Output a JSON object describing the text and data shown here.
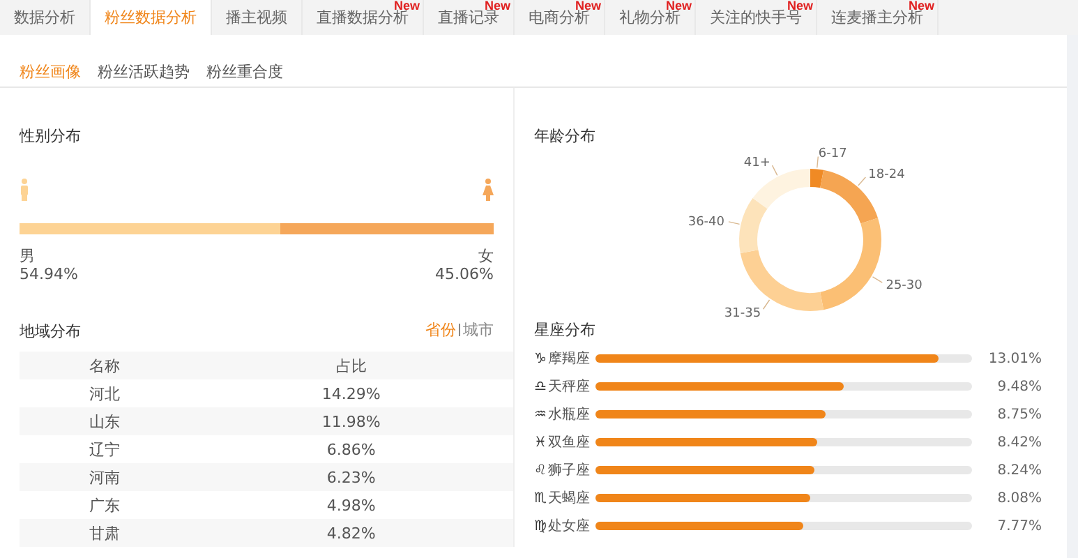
{
  "tabs": [
    {
      "label": "数据分析",
      "selected": false
    },
    {
      "label": "粉丝数据分析",
      "selected": true
    },
    {
      "label": "播主视频",
      "selected": false
    },
    {
      "label": "直播数据分析",
      "selected": false,
      "badge": "New"
    },
    {
      "label": "直播记录",
      "selected": false,
      "badge": "New"
    },
    {
      "label": "电商分析",
      "selected": false,
      "badge": "New"
    },
    {
      "label": "礼物分析",
      "selected": false,
      "badge": "New"
    },
    {
      "label": "关注的快手号",
      "selected": false,
      "badge": "New"
    },
    {
      "label": "连麦播主分析",
      "selected": false,
      "badge": "New"
    }
  ],
  "subtabs": [
    {
      "label": "粉丝画像",
      "selected": true
    },
    {
      "label": "粉丝活跃趋势",
      "selected": false
    },
    {
      "label": "粉丝重合度",
      "selected": false
    }
  ],
  "gender": {
    "title": "性别分布",
    "male_label": "男",
    "male_percent": "54.94%",
    "female_label": "女",
    "female_percent": "45.06%",
    "level": 0.5494
  },
  "age": {
    "title": "年龄分布",
    "segments": [
      {
        "label": "6-17",
        "color": "#f08a24"
      },
      {
        "label": "18-24",
        "color": "#f5a552"
      },
      {
        "label": "25-30",
        "color": "#fbbf74"
      },
      {
        "label": "31-35",
        "color": "#fdd094"
      },
      {
        "label": "36-40",
        "color": "#fde3ba"
      },
      {
        "label": "41+",
        "color": "#fef3e0"
      }
    ]
  },
  "region": {
    "title": "地域分布",
    "toggle": [
      {
        "label": "省份",
        "selected": true
      },
      {
        "label": "城市",
        "selected": false
      }
    ],
    "columns": [
      "名称",
      "占比"
    ],
    "rows": [
      [
        "河北",
        "14.29%"
      ],
      [
        "山东",
        "11.98%"
      ],
      [
        "辽宁",
        "6.86%"
      ],
      [
        "河南",
        "6.23%"
      ],
      [
        "广东",
        "4.98%"
      ],
      [
        "甘肃",
        "4.82%"
      ]
    ]
  },
  "zodiac": {
    "title": "星座分布",
    "items": [
      {
        "symbol": "♑",
        "name": "摩羯座",
        "level": 0.91,
        "percent": "13.01%"
      },
      {
        "symbol": "♎",
        "name": "天秤座",
        "level": 0.66,
        "percent": "9.48%"
      },
      {
        "symbol": "♒",
        "name": "水瓶座",
        "level": 0.61,
        "percent": "8.75%"
      },
      {
        "symbol": "♓",
        "name": "双鱼座",
        "level": 0.59,
        "percent": "8.42%"
      },
      {
        "symbol": "♌",
        "name": "狮子座",
        "level": 0.58,
        "percent": "8.24%"
      },
      {
        "symbol": "♏",
        "name": "天蝎座",
        "level": 0.57,
        "percent": "8.08%"
      },
      {
        "symbol": "♍",
        "name": "处女座",
        "level": 0.55,
        "percent": "7.77%"
      }
    ]
  }
}
